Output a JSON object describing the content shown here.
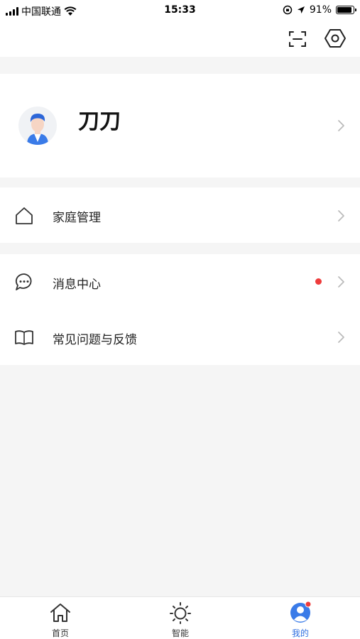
{
  "status_bar": {
    "carrier": "中国联通",
    "time": "15:33",
    "battery": "91%",
    "battery_level": 0.91
  },
  "top_bar": {
    "scan_icon": "scan-icon",
    "settings_icon": "settings-hexagon-icon"
  },
  "profile": {
    "name": "刀刀",
    "avatar_icon": "user-avatar-icon"
  },
  "menu": {
    "family": {
      "label": "家庭管理",
      "icon": "home-icon"
    },
    "messages": {
      "label": "消息中心",
      "icon": "chat-bubble-icon",
      "has_unread": true
    },
    "faq": {
      "label": "常见问题与反馈",
      "icon": "book-icon"
    }
  },
  "tabs": [
    {
      "label": "首页",
      "icon": "home-icon",
      "active": false
    },
    {
      "label": "智能",
      "icon": "sun-icon",
      "active": false
    },
    {
      "label": "我的",
      "icon": "profile-icon",
      "active": true,
      "badge": true
    }
  ],
  "colors": {
    "accent": "#2f6fe0",
    "badge": "#ee3b3b",
    "background": "#f5f5f5"
  }
}
